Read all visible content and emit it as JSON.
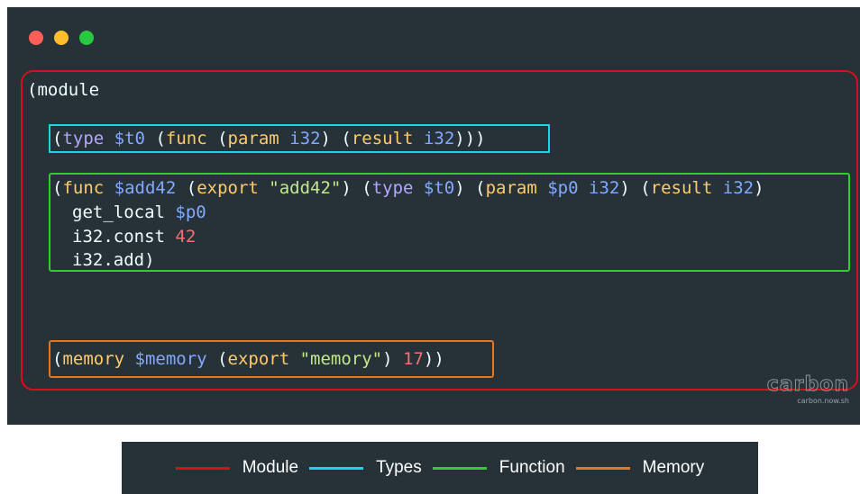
{
  "window": {
    "controls": [
      {
        "name": "close",
        "color": "#ff5f56"
      },
      {
        "name": "minimize",
        "color": "#ffbd2e"
      },
      {
        "name": "zoom",
        "color": "#27c93f"
      }
    ]
  },
  "code": {
    "module_open": "(module",
    "type_line": {
      "open": "(",
      "kw_type": "type",
      "sp1": " ",
      "id": "$t0",
      "sp2": " (",
      "kw_func": "func",
      "sp3": " (",
      "kw_param": "param",
      "sp4": " ",
      "t1": "i32",
      "close1": ") (",
      "kw_result": "result",
      "sp5": " ",
      "t2": "i32",
      "close2": ")))"
    },
    "func_line": {
      "open": "(",
      "kw_func": "func",
      "sp1": " ",
      "id": "$add42",
      "sp2": " (",
      "kw_export": "export",
      "sp3": " ",
      "name": "\"add42\"",
      "sp4": ") (",
      "kw_type": "type",
      "sp5": " ",
      "tid": "$t0",
      "sp6": ") (",
      "kw_param": "param",
      "sp7": " ",
      "pid": "$p0",
      "sp8": " ",
      "pt": "i32",
      "sp9": ") (",
      "kw_result": "result",
      "sp10": " ",
      "rt": "i32",
      "close": ")"
    },
    "get_local": {
      "op": "get_local",
      "sp": " ",
      "arg": "$p0"
    },
    "i32_const": {
      "op": "i32.const",
      "sp": " ",
      "arg": "42"
    },
    "i32_add": {
      "op": "i32.add",
      "close": ")"
    },
    "memory_line": {
      "open": "(",
      "kw_memory": "memory",
      "sp1": " ",
      "id": "$memory",
      "sp2": " (",
      "kw_export": "export",
      "sp3": " ",
      "name": "\"memory\"",
      "sp4": ") ",
      "pages": "17",
      "close": "))"
    }
  },
  "branding": {
    "name": "carbon",
    "url": "carbon.now.sh"
  },
  "legend": [
    {
      "label": "Module",
      "color": "#d50f1d"
    },
    {
      "label": "Types",
      "color": "#1bd7e6"
    },
    {
      "label": "Function",
      "color": "#2ed12a"
    },
    {
      "label": "Memory",
      "color": "#e8761d"
    }
  ]
}
